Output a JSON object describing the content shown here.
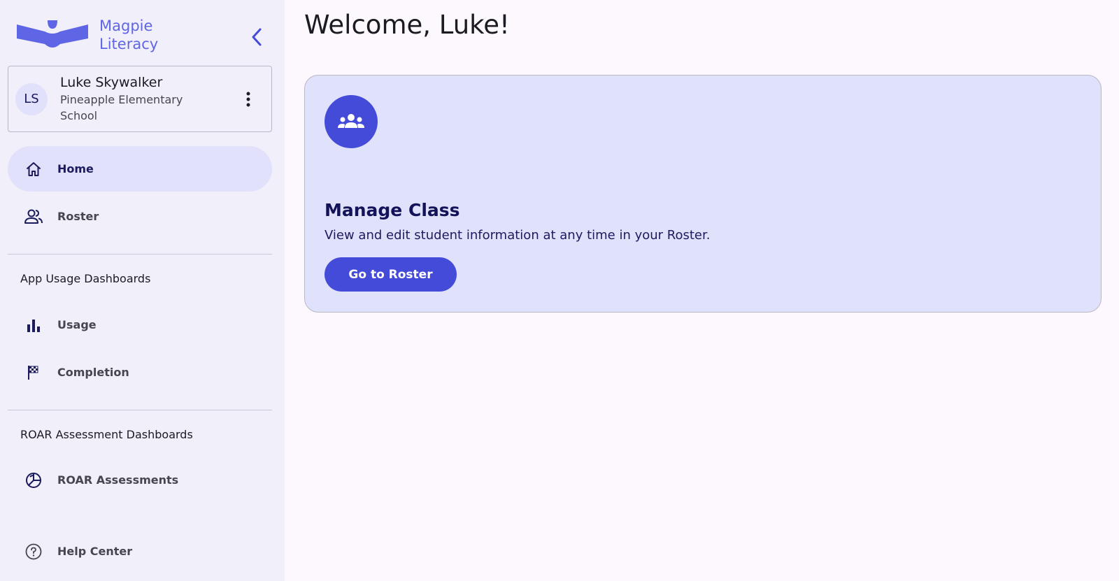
{
  "brand": {
    "name_line1": "Magpie",
    "name_line2": "Literacy",
    "color": "#5f66e6"
  },
  "user": {
    "initials": "LS",
    "name": "Luke Skywalker",
    "school": "Pineapple Elementary School"
  },
  "nav": {
    "home": "Home",
    "roster": "Roster"
  },
  "sections": {
    "app_usage": {
      "title": "App Usage Dashboards",
      "items": [
        "Usage",
        "Completion"
      ]
    },
    "roar": {
      "title": "ROAR Assessment Dashboards",
      "items": [
        "ROAR Assessments"
      ]
    }
  },
  "help": "Help Center",
  "main": {
    "welcome": "Welcome, Luke!",
    "card": {
      "title": "Manage Class",
      "description": "View and edit student information at any time in your Roster.",
      "button": "Go to Roster"
    }
  },
  "colors": {
    "accent": "#444bd9",
    "sidebar_bg": "#f1eff9",
    "card_bg": "#e0e1fb",
    "active_nav_bg": "#e1e1fb"
  },
  "icons": {
    "collapse": "chevron-left-icon",
    "menu": "more-vertical-icon",
    "home": "home-icon",
    "roster": "people-icon",
    "usage": "bar-chart-icon",
    "completion": "checkered-flag-icon",
    "roar": "pie-chart-icon",
    "help": "help-circle-icon",
    "card": "groups-icon"
  }
}
